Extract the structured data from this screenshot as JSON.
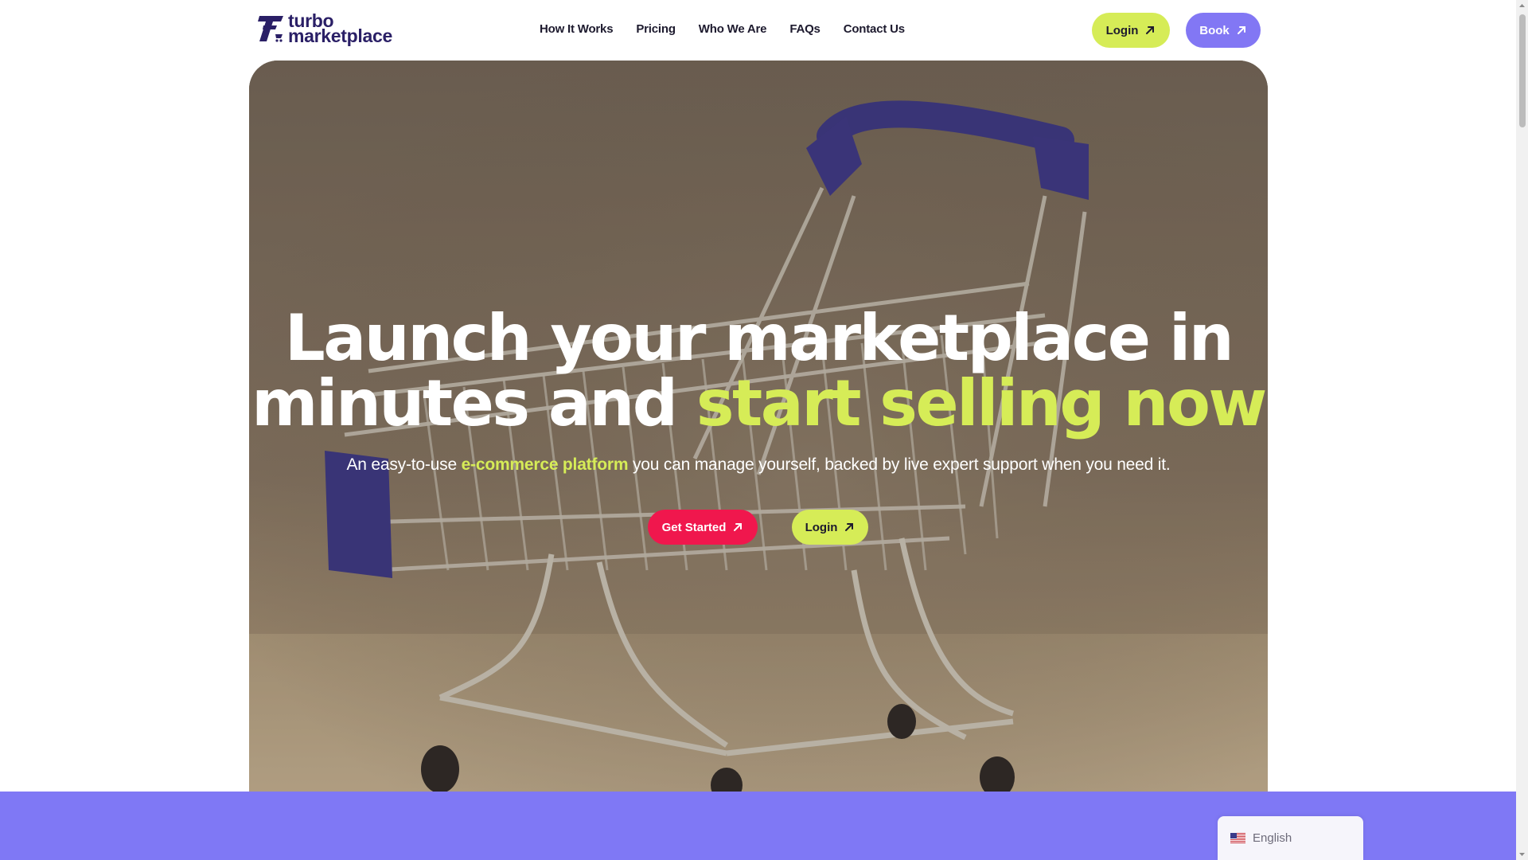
{
  "header": {
    "brand": {
      "line1": "turbo",
      "line2": "marketplace"
    },
    "nav": [
      {
        "label": "How It Works"
      },
      {
        "label": "Pricing"
      },
      {
        "label": "Who We Are"
      },
      {
        "label": "FAQs"
      },
      {
        "label": "Contact Us"
      }
    ],
    "login_label": "Login",
    "book_label": "Book"
  },
  "hero": {
    "headline_line1": "Launch your marketplace in",
    "headline_line2_plain": "minutes and ",
    "headline_line2_accent": "start selling now",
    "subline_pre": "An easy-to-use ",
    "subline_accent": "e-commerce platform",
    "subline_post": " you can manage yourself, backed by live expert support when you need it.",
    "cta_primary": "Get Started",
    "cta_secondary": "Login"
  },
  "language_switcher": {
    "label": "English",
    "flag": "us-flag-icon"
  },
  "colors": {
    "lime": "#d6ec57",
    "purple": "#8277f4",
    "band": "#7f78f5",
    "red": "#f0174d",
    "navy": "#2a1f66"
  }
}
